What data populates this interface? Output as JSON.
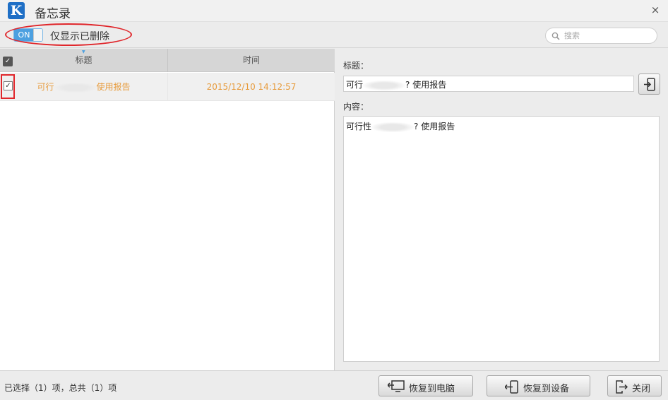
{
  "window": {
    "logo_letter": "K",
    "title": "备忘录",
    "close_glyph": "×"
  },
  "toolbar": {
    "toggle_state": "ON",
    "toggle_label": "仅显示已删除",
    "search_placeholder": "搜索"
  },
  "list": {
    "columns": [
      "标题",
      "时间"
    ],
    "rows": [
      {
        "checked": true,
        "title_prefix": "可行",
        "title_suffix": "使用报告",
        "time": "2015/12/10 14:12:57"
      }
    ]
  },
  "detail": {
    "title_label": "标题：",
    "title_prefix": "可行",
    "title_suffix": "? 使用报告",
    "content_label": "内容：",
    "content_prefix": "可行性",
    "content_suffix": "? 使用报告"
  },
  "footer": {
    "status": "已选择（1）项，总共（1）项",
    "restore_pc_label": "恢复到电脑",
    "restore_device_label": "恢复到设备",
    "close_label": "关闭"
  },
  "icons": {
    "app": "kingroot-logo",
    "search": "search-icon",
    "export": "export-to-device-icon",
    "restore_pc": "computer-icon",
    "restore_device": "phone-icon",
    "close": "exit-icon"
  },
  "colors": {
    "accent": "#4da0e0",
    "row_text": "#e79b3c",
    "highlight": "#e0262b"
  }
}
